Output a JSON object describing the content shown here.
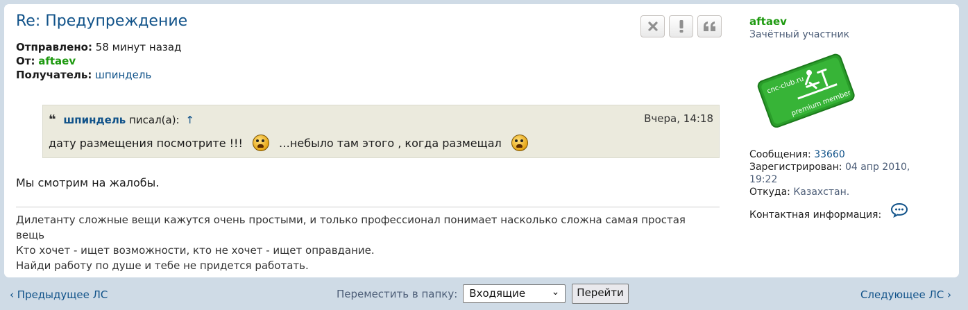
{
  "post": {
    "title": "Re: Предупреждение",
    "sent_label": "Отправлено:",
    "sent_value": "58 минут назад",
    "from_label": "От:",
    "from_value": "aftaev",
    "recipient_label": "Получатель:",
    "recipient_value": "шпиндель"
  },
  "actions": {
    "delete_icon": "close-icon",
    "report_icon": "exclamation-icon",
    "quote_icon": "quote-icon"
  },
  "quote": {
    "author": "шпиндель",
    "says": "писал(а):",
    "arrow": "↑",
    "time": "Вчера, 14:18",
    "text_part1": "дату размещения посмотрите !!!",
    "text_part2": "…небыло там этого , когда размещал"
  },
  "message": {
    "text": "Мы смотрим на жалобы."
  },
  "signature": {
    "lines": [
      "Дилетанту сложные вещи кажутся очень простыми, и только профессионал понимает насколько сложна самая простая вещь",
      "Кто хочет - ищет возможности, кто не хочет - ищет оправдание.",
      "Найди работу по душе и тебе не придется работать."
    ]
  },
  "profile": {
    "username": "aftaev",
    "rank": "Зачётный участник",
    "badge_text_top": "cnc-club.ru",
    "badge_text_bottom": "premium member",
    "posts_label": "Сообщения:",
    "posts_value": "33660",
    "registered_label": "Зарегистрирован:",
    "registered_value": "04 апр 2010, 19:22",
    "location_label": "Откуда:",
    "location_value": "Казахстан.",
    "contact_label": "Контактная информация:"
  },
  "footer": {
    "prev_label": "Предыдущее ЛС",
    "next_label": "Следующее ЛС",
    "move_label": "Переместить в папку:",
    "folder_selected": "Входящие",
    "go_label": "Перейти"
  },
  "colors": {
    "background": "#cfdbe6",
    "link": "#105289",
    "username": "#1e9a10",
    "quote_bg": "#ebeadd"
  }
}
